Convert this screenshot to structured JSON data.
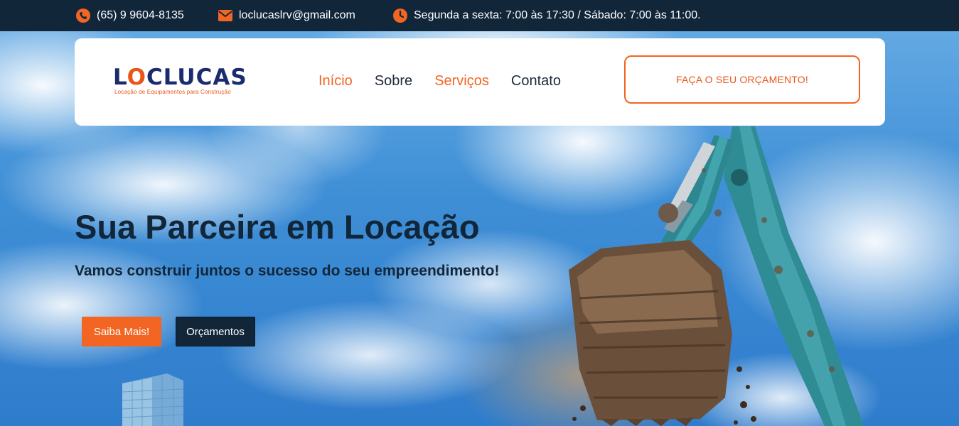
{
  "topbar": {
    "phone": "(65) 9 9604-8135",
    "email": "loclucaslrv@gmail.com",
    "hours": "Segunda a sexta: 7:00 às 17:30 / Sábado: 7:00 às 11:00.",
    "icons": [
      "phone-icon",
      "envelope-icon",
      "clock-icon"
    ]
  },
  "logo": {
    "word_part1": "L",
    "word_o": "O",
    "word_part2": "CLUCAS",
    "tagline": "Locação de Equipamentos para Construção"
  },
  "nav": {
    "items": [
      {
        "label": "Início",
        "active": true
      },
      {
        "label": "Sobre",
        "active": false
      },
      {
        "label": "Serviços",
        "active": true
      },
      {
        "label": "Contato",
        "active": false
      }
    ]
  },
  "header": {
    "cta_label": "FAÇA O SEU ORÇAMENTO!"
  },
  "hero": {
    "title": "Sua Parceira em Locação",
    "subtitle": "Vamos construir juntos o sucesso do seu empreendimento!",
    "primary_button": "Saiba Mais!",
    "secondary_button": "Orçamentos"
  },
  "colors": {
    "accent": "#f26522",
    "dark": "#12263a",
    "logo_blue": "#1b2b6f"
  }
}
